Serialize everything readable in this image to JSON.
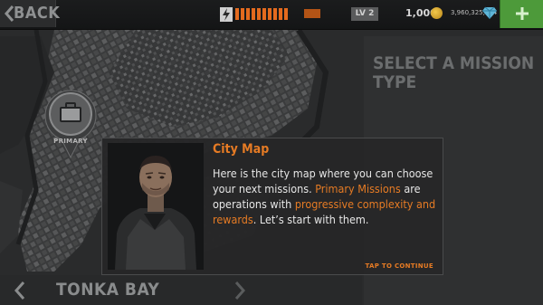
{
  "topbar": {
    "back_label": "BACK",
    "energy_total": 10,
    "energy_filled": 10,
    "level": "LV 2",
    "coins": "1,000",
    "gems": "3,960,325,134",
    "icons": [
      "energy-icon",
      "coin-icon",
      "gem-icon",
      "plus-icon"
    ]
  },
  "panel": {
    "title": "SELECT A MISSION TYPE"
  },
  "pin": {
    "label": "PRIMARY"
  },
  "district": {
    "name": "TONKA BAY"
  },
  "dialog": {
    "title": "City Map",
    "body_1": "Here is the city map where you can choose your next missions. ",
    "hl_1": "Primary Missions",
    "body_2": " are operations with ",
    "hl_2": "progressive complexity and rewards",
    "body_3": ". Let’s start with them.",
    "tap": "TAP TO CONTINUE"
  },
  "colors": {
    "accent": "#e67b24",
    "plus_button": "#4d9a3a"
  }
}
